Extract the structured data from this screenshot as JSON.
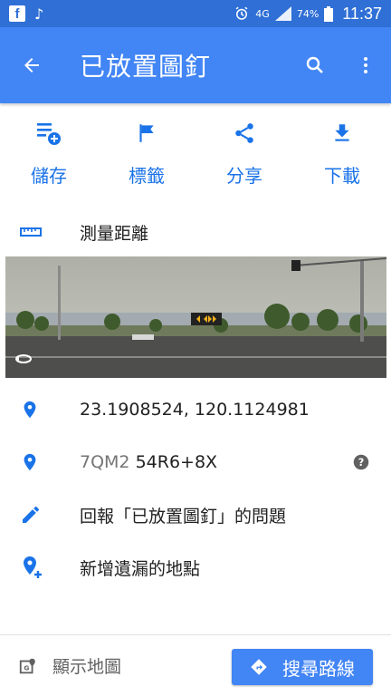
{
  "status_bar": {
    "network": "4G",
    "battery": "74%",
    "time": "11:37"
  },
  "app_bar": {
    "title": "已放置圖釘"
  },
  "actions": [
    {
      "label": "儲存",
      "icon": "playlist-add-icon"
    },
    {
      "label": "標籤",
      "icon": "flag-icon"
    },
    {
      "label": "分享",
      "icon": "share-icon"
    },
    {
      "label": "下載",
      "icon": "download-icon"
    }
  ],
  "measure": {
    "label": "測量距離"
  },
  "details": {
    "coordinates": "23.1908524, 120.1124981",
    "pluscode_prefix": "7QM2",
    "pluscode": "54R6+8X",
    "report": "回報「已放置圖釘」的問題",
    "add_place": "新增遺漏的地點"
  },
  "bottom_bar": {
    "show_map": "顯示地圖",
    "directions": "搜尋路線"
  },
  "colors": {
    "status_bar": "#2f6fd6",
    "app_bar": "#4285f4",
    "accent": "#1a73e8"
  }
}
